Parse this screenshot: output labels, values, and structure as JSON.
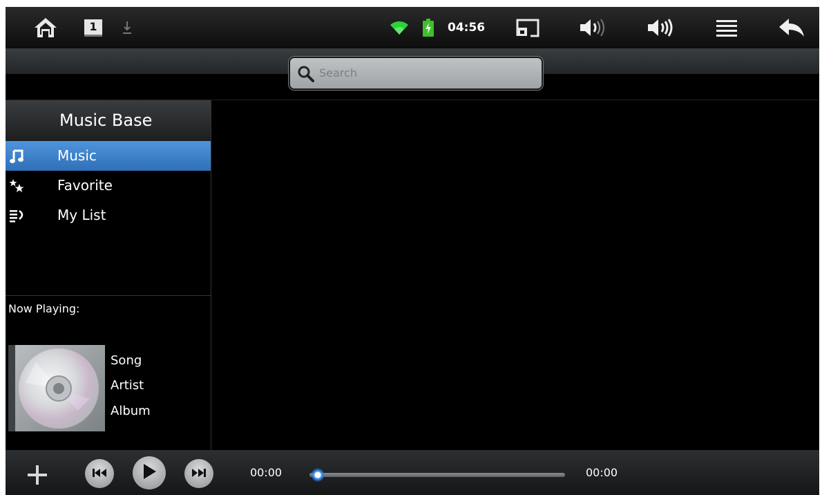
{
  "status_bar": {
    "clock": "04:56",
    "tab_badge": "1",
    "icons": [
      "home-icon",
      "tab-badge-icon",
      "download-icon",
      "wifi-icon",
      "battery-icon",
      "screen-rotate-icon",
      "volume-down-icon",
      "volume-up-icon",
      "menu-icon",
      "back-icon"
    ],
    "colors": {
      "wifi": "#2fd13a",
      "battery": "#3fbf2a"
    }
  },
  "search": {
    "placeholder": "Search"
  },
  "sidebar": {
    "title": "Music Base",
    "items": [
      {
        "label": "Music",
        "icon": "music-note-icon",
        "selected": true
      },
      {
        "label": "Favorite",
        "icon": "stars-icon",
        "selected": false
      },
      {
        "label": "My List",
        "icon": "playlist-icon",
        "selected": false
      }
    ],
    "accent": "#3b82cc"
  },
  "now_playing": {
    "title": "Now Playing:",
    "song": "Song",
    "artist": "Artist",
    "album": "Album"
  },
  "player": {
    "add_icon": "plus-icon",
    "controls": [
      "previous-icon",
      "play-icon",
      "next-icon"
    ],
    "elapsed": "00:00",
    "total": "00:00",
    "progress": 0
  }
}
